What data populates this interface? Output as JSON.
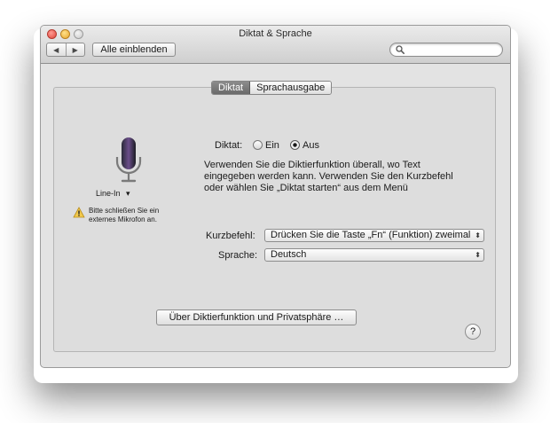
{
  "window": {
    "title": "Diktat & Sprache"
  },
  "toolbar": {
    "back_glyph": "◀",
    "forward_glyph": "▶",
    "show_all_label": "Alle einblenden",
    "search_placeholder": ""
  },
  "tabs": [
    {
      "label": "Diktat",
      "active": true
    },
    {
      "label": "Sprachausgabe",
      "active": false
    }
  ],
  "mic": {
    "input_label": "Line-In",
    "input_arrow": "▾",
    "warning": "Bitte schließen Sie ein externes Mikrofon an."
  },
  "dictation": {
    "label": "Diktat:",
    "option_on": "Ein",
    "option_off": "Aus",
    "selected": "Aus",
    "description": "Verwenden Sie die Diktierfunktion überall, wo Text eingegeben werden kann. Verwenden Sie den Kurzbefehl oder wählen Sie „Diktat starten“ aus dem Menü"
  },
  "shortcut": {
    "label": "Kurzbefehl:",
    "value": "Drücken Sie die Taste „Fn“ (Funktion) zweimal"
  },
  "language": {
    "label": "Sprache:",
    "value": "Deutsch"
  },
  "select_arrow": "⬍",
  "privacy_button": "Über Diktierfunktion und Privatsphäre …",
  "help_button": "?",
  "colors": {
    "window_bg": "#e3e3e3",
    "tab_active": "#7a7a7a",
    "warning": "#f2c94c"
  }
}
